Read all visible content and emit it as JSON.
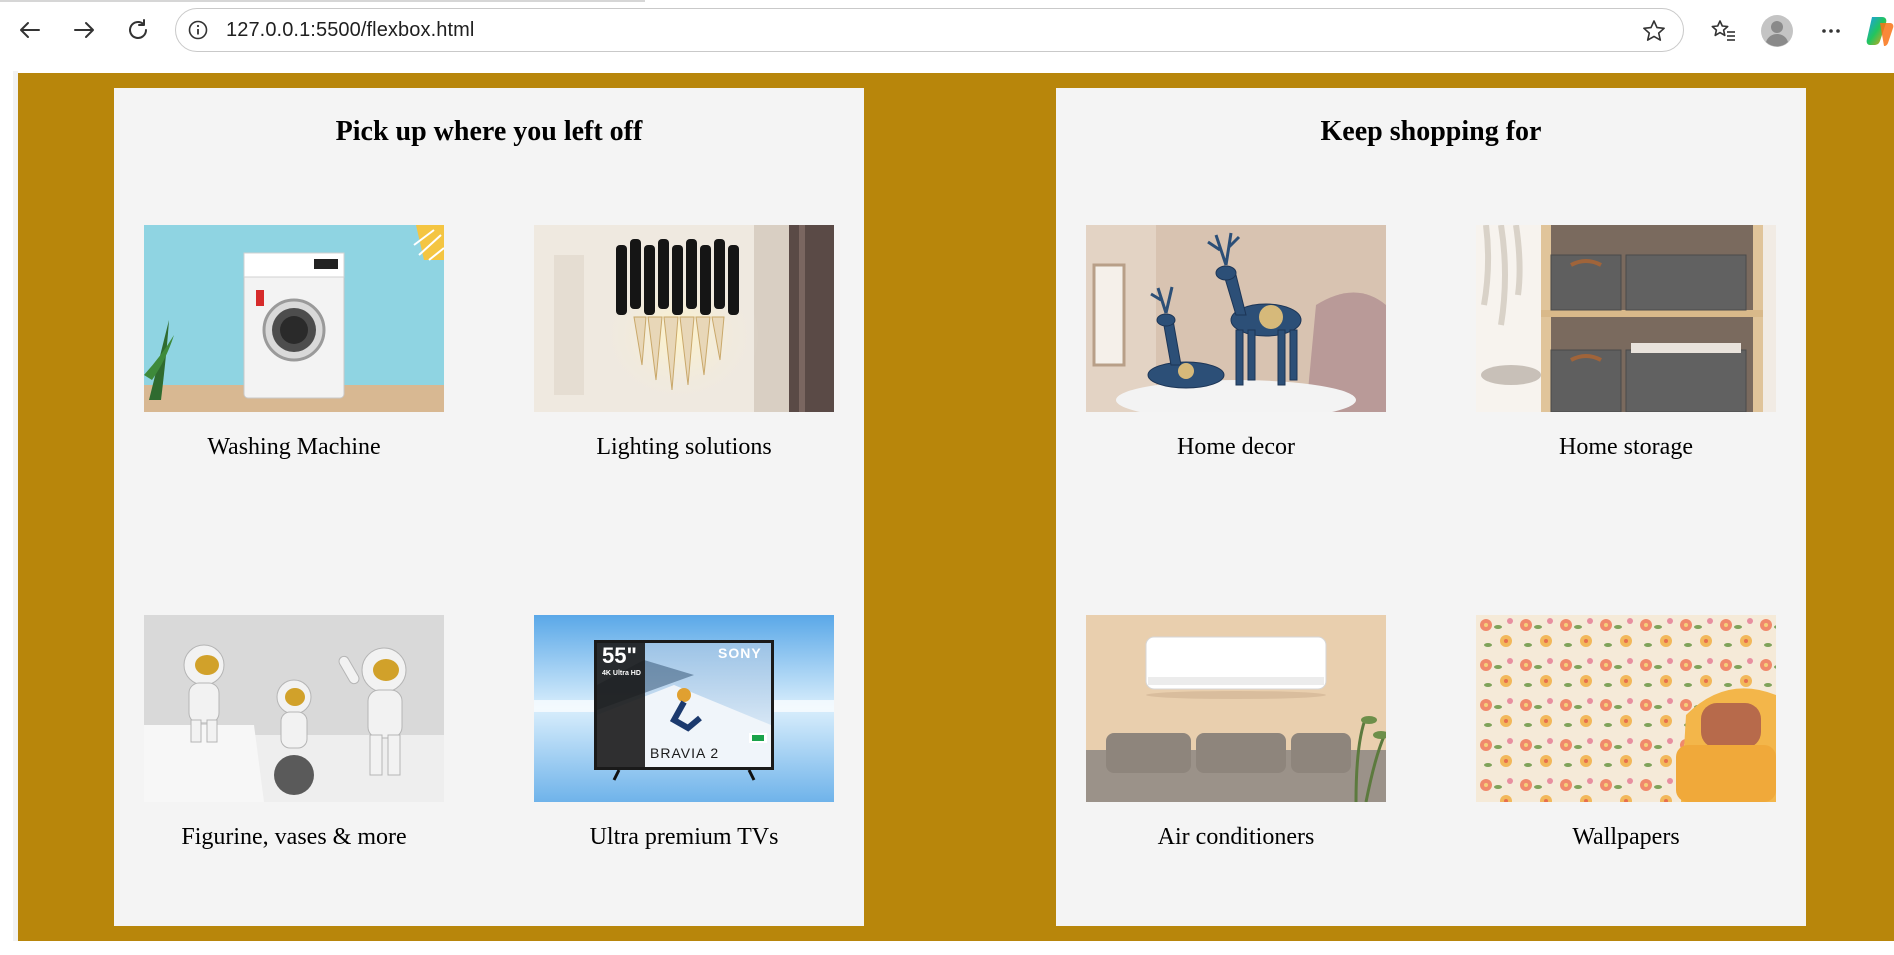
{
  "browser": {
    "url": "127.0.0.1:5500/flexbox.html",
    "back_icon": "arrow-left-icon",
    "forward_icon": "arrow-right-icon",
    "reload_icon": "reload-icon",
    "info_icon": "info-icon",
    "favorite_icon": "star-icon",
    "favorites_icon": "favorites-list-icon",
    "profile_icon": "profile-avatar-icon",
    "menu_icon": "more-dots-icon",
    "copilot_icon": "copilot-icon"
  },
  "colors": {
    "page_background": "#b8860b",
    "card_background": "#f4f4f4"
  },
  "cards": [
    {
      "title": "Pick up where you left off",
      "items": [
        {
          "caption": "Washing Machine",
          "image": "washing-machine"
        },
        {
          "caption": "Lighting solutions",
          "image": "wall-lamp"
        },
        {
          "caption": "Figurine, vases & more",
          "image": "astronaut-figurines"
        },
        {
          "caption": "Ultra premium TVs",
          "image": "sony-tv"
        }
      ]
    },
    {
      "title": "Keep shopping for",
      "items": [
        {
          "caption": "Home decor",
          "image": "deer-figurines"
        },
        {
          "caption": "Home storage",
          "image": "storage-boxes"
        },
        {
          "caption": "Air conditioners",
          "image": "wall-air-conditioner"
        },
        {
          "caption": "Wallpapers",
          "image": "floral-wallpaper"
        }
      ]
    }
  ],
  "tv_overlay": {
    "size": "55\"",
    "resolution": "4K Ultra HD",
    "brand": "SONY",
    "model": "BRAVIA 2"
  }
}
